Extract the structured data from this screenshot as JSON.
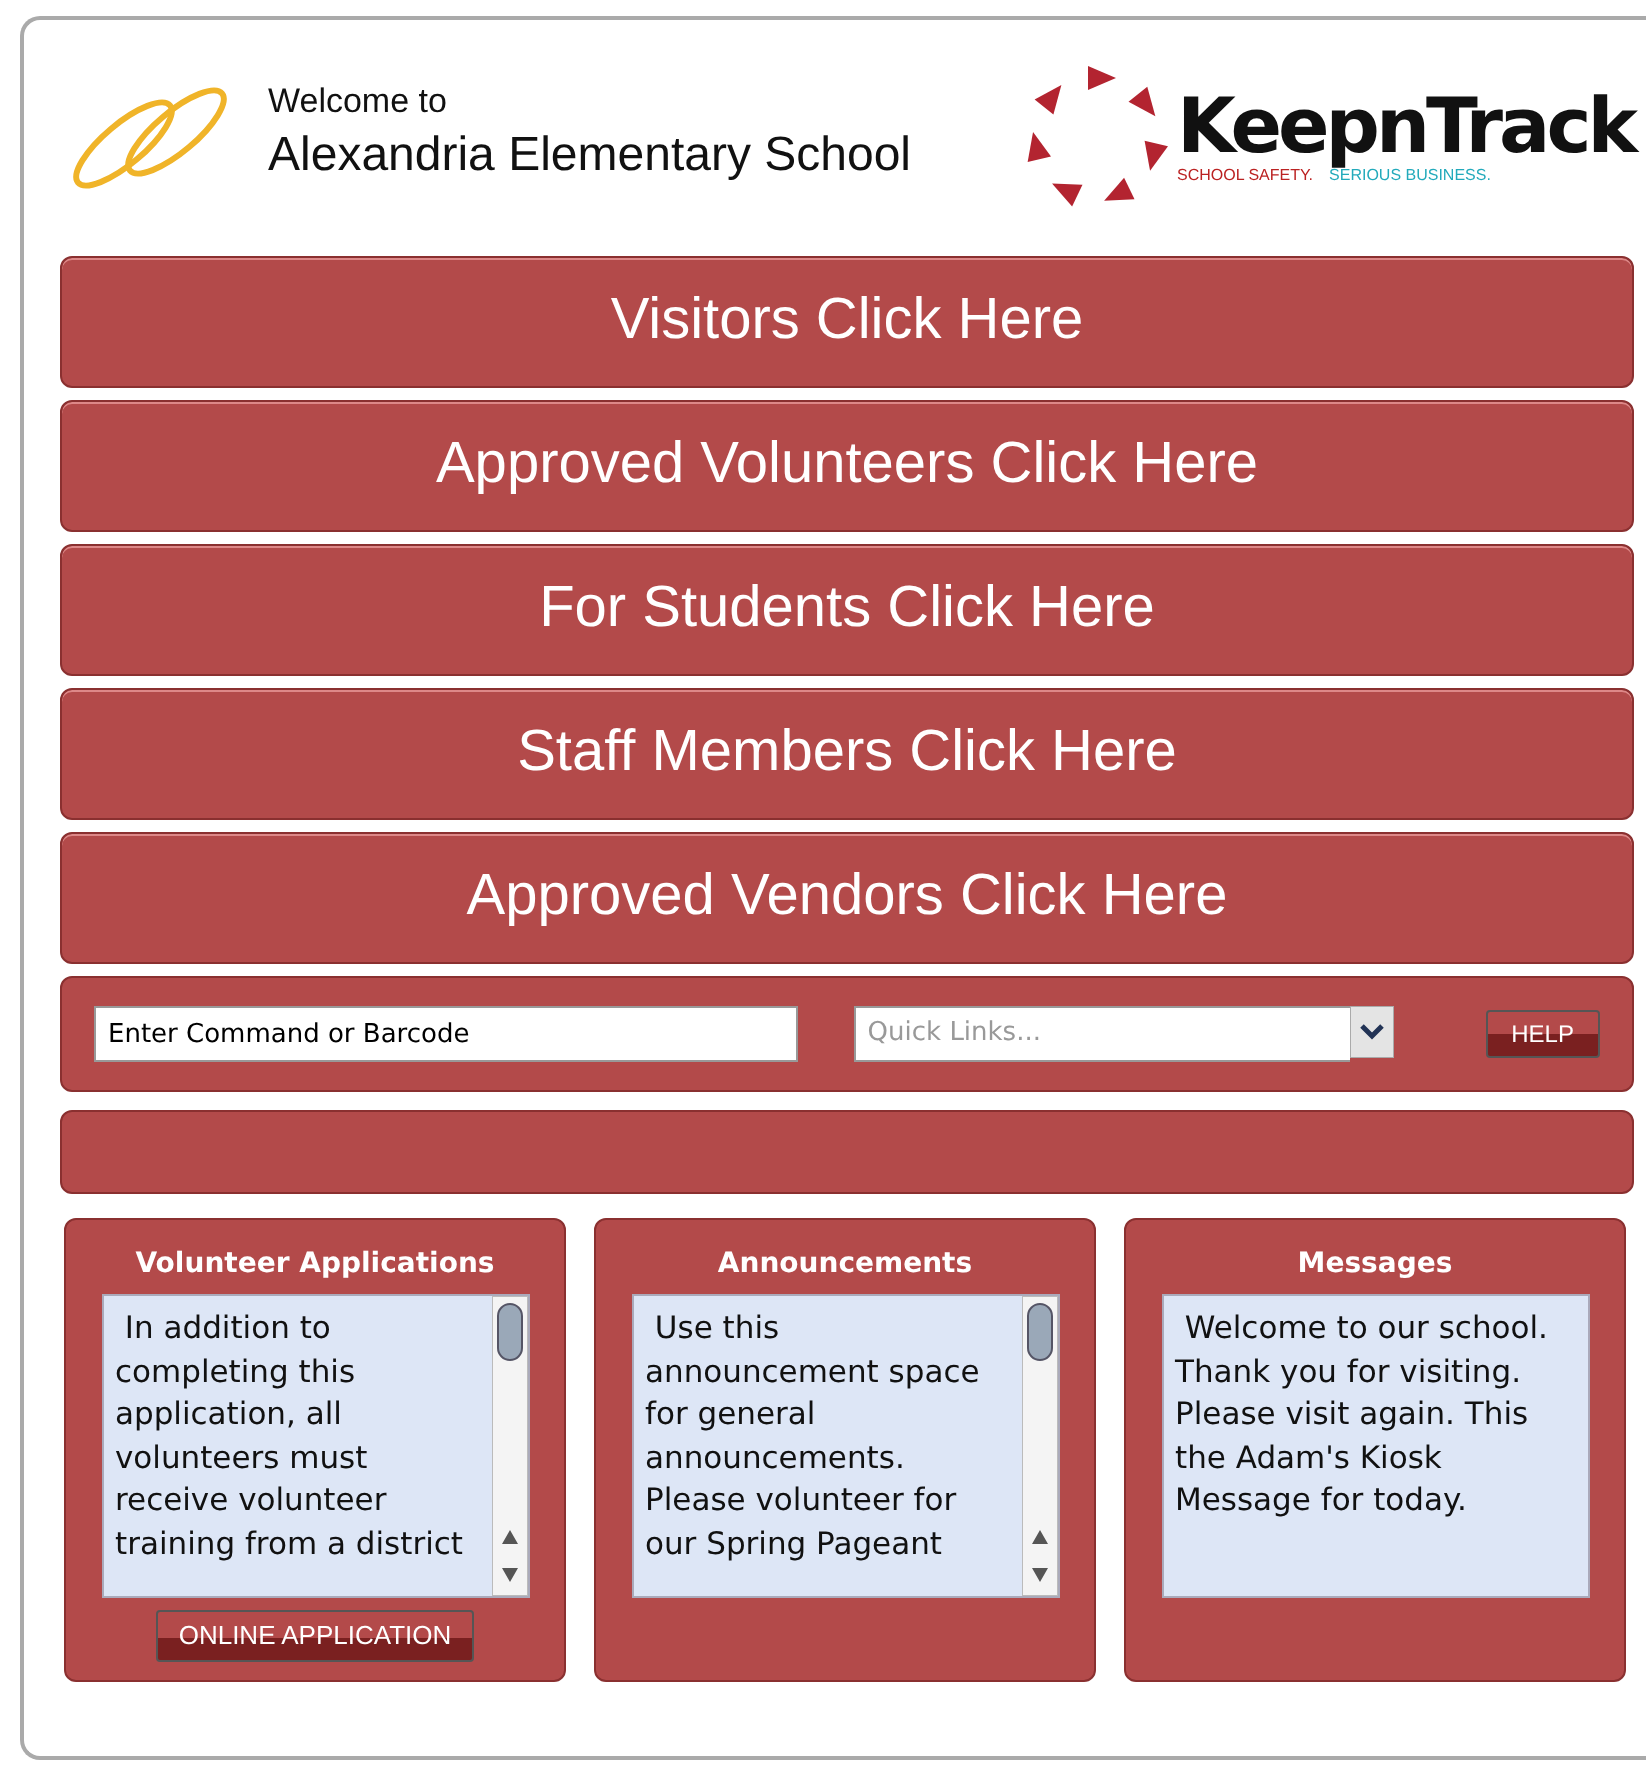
{
  "header": {
    "welcome": "Welcome to",
    "school": "Alexandria Elementary School",
    "brand": {
      "name": "KeepnTrack",
      "tagline_1": "SCHOOL SAFETY.",
      "tagline_2": "SERIOUS BUSINESS."
    }
  },
  "buttons": [
    {
      "label": "Visitors Click Here"
    },
    {
      "label": "Approved Volunteers Click Here"
    },
    {
      "label": "For Students Click Here"
    },
    {
      "label": "Staff Members Click Here"
    },
    {
      "label": "Approved Vendors Click Here"
    }
  ],
  "command_bar": {
    "command_field": {
      "value": "Enter Command or Barcode"
    },
    "quick_links": {
      "placeholder": "Quick Links..."
    },
    "help_button": "HELP"
  },
  "panels": [
    {
      "title": "Volunteer Applications",
      "text": "In addition to completing this application, all volunteers must receive volunteer training from a district",
      "scrollable": true,
      "button": "ONLINE APPLICATION"
    },
    {
      "title": "Announcements",
      "text": "Use this announcement space for general announcements. Please volunteer for our Spring Pageant",
      "scrollable": true
    },
    {
      "title": "Messages",
      "text": "Welcome to our school. Thank you for visiting. Please visit again. This the Adam's Kiosk Message for today.",
      "scrollable": false
    }
  ]
}
